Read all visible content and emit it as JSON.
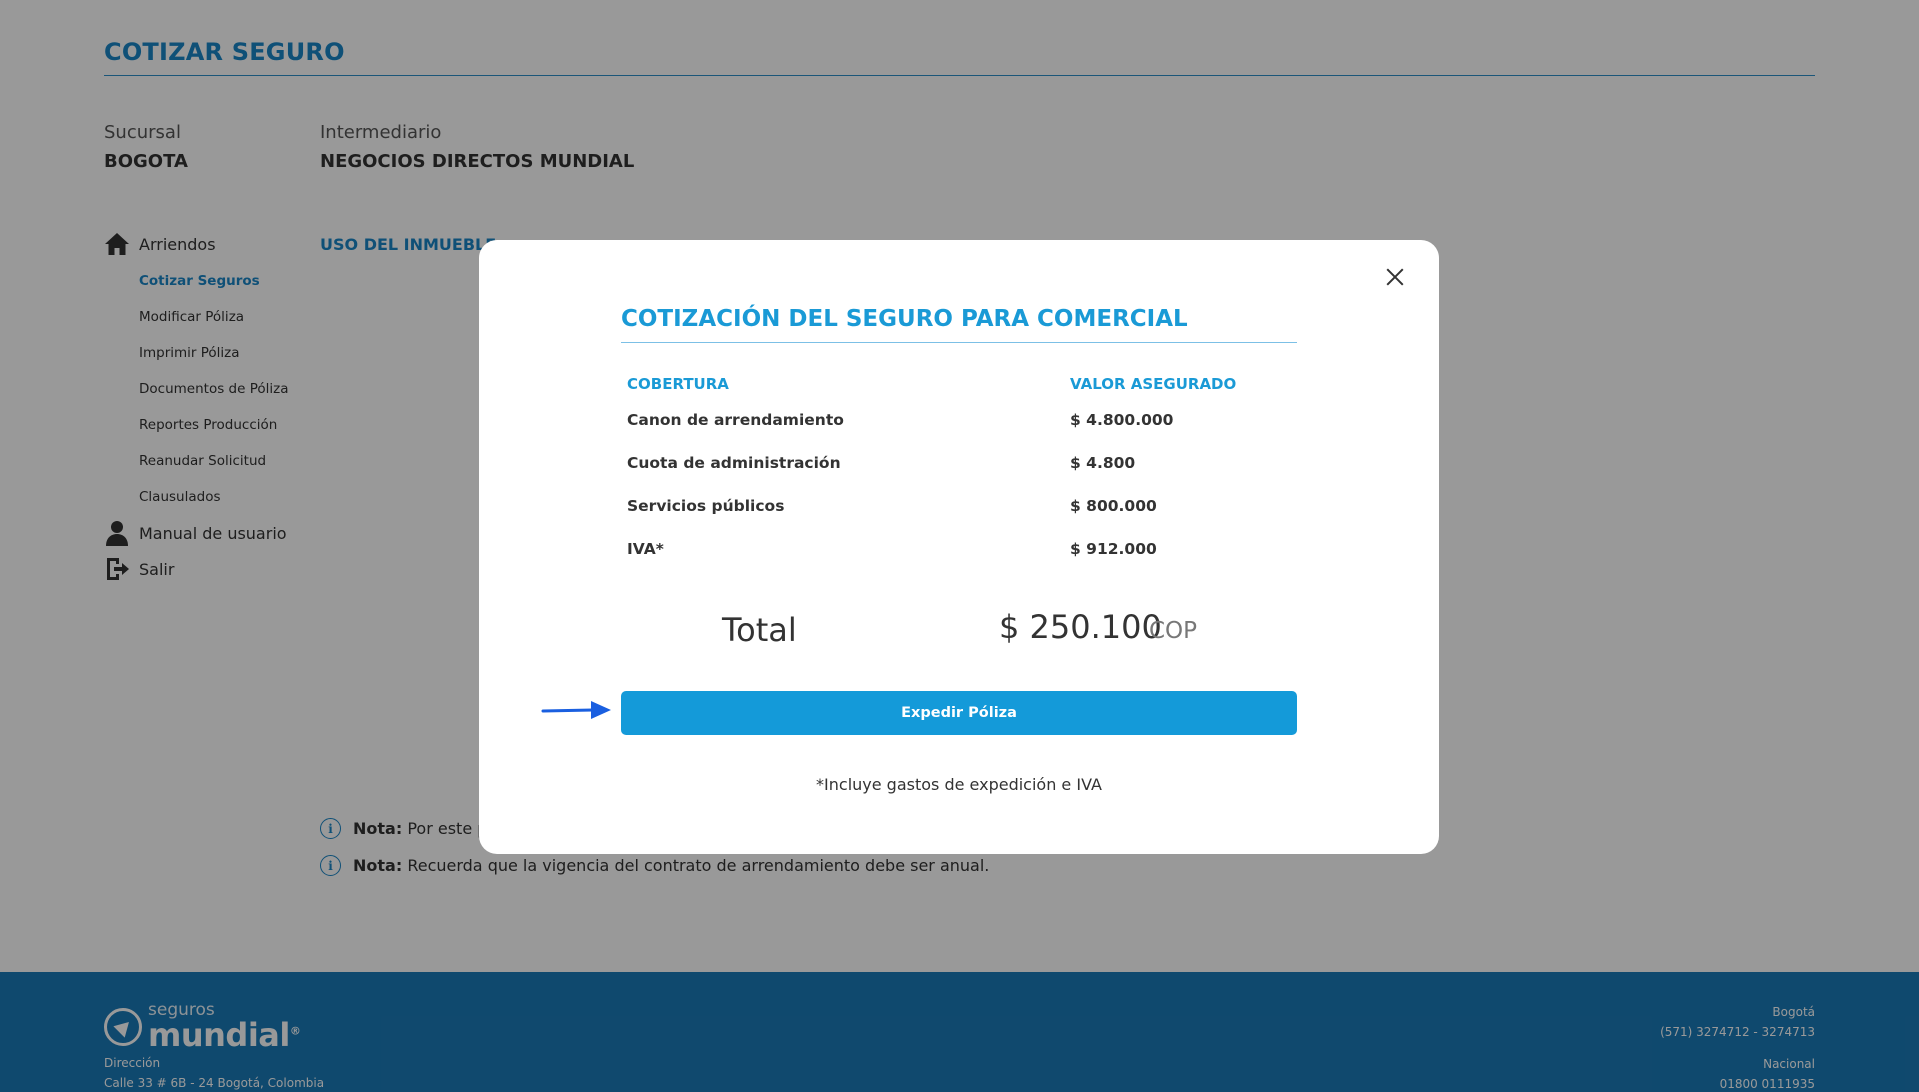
{
  "page": {
    "title": "COTIZAR SEGURO",
    "sucursal_label": "Sucursal",
    "sucursal_value": "BOGOTA",
    "intermediario_label": "Intermediario",
    "intermediario_value": "NEGOCIOS DIRECTOS MUNDIAL",
    "section_heading": "USO DEL INMUEBLE"
  },
  "sidebar": {
    "main_item": "Arriendos",
    "sub_items": [
      "Cotizar Seguros",
      "Modificar Póliza",
      "Imprimir Póliza",
      "Documentos de Póliza",
      "Reportes Producción",
      "Reanudar Solicitud",
      "Clausulados"
    ],
    "manual": "Manual de usuario",
    "logout": "Salir"
  },
  "notes": [
    {
      "bold": "Nota:",
      "text": "Por este po"
    },
    {
      "bold": "Nota:",
      "text": "Recuerda que la vigencia del contrato de arrendamiento debe ser anual."
    }
  ],
  "modal": {
    "title": "COTIZACIÓN DEL SEGURO PARA COMERCIAL",
    "col_cobertura": "COBERTURA",
    "col_valor": "VALOR ASEGURADO",
    "rows": [
      {
        "label": "Canon de arrendamiento",
        "value": "$ 4.800.000"
      },
      {
        "label": "Cuota de administración",
        "value": "$ 4.800"
      },
      {
        "label": "Servicios públicos",
        "value": "$ 800.000"
      },
      {
        "label": "IVA*",
        "value": "$ 912.000"
      }
    ],
    "total_label": "Total",
    "total_value": "$ 250.100",
    "total_currency": "COP",
    "button_label": "Expedir Póliza",
    "footnote": "*Incluye gastos de expedición e IVA"
  },
  "footer": {
    "logo_small": "seguros",
    "logo_big": "mundial",
    "logo_mark": "®",
    "address_label": "Dirección",
    "address": "Calle 33 # 6B - 24 Bogotá, Colombia",
    "city": "Bogotá",
    "city_phones": "(571) 3274712 - 3274713",
    "national_label": "Nacional",
    "national_phone": "01800 0111935"
  },
  "colors": {
    "accent": "#1a9ad6",
    "primary_blue": "#1a86c7",
    "footer_bg": "#1a7ab8",
    "arrow": "#1a5fe0"
  }
}
